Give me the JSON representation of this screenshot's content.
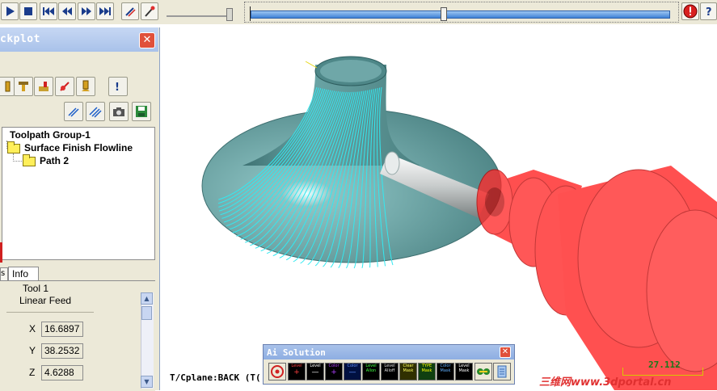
{
  "toolbar": {
    "buttons": [
      "play-icon",
      "stop-icon",
      "skip-start-icon",
      "step-back-icon",
      "step-forward-icon",
      "skip-end-icon",
      "stylus-icon",
      "wand-icon"
    ],
    "right_buttons": [
      "alert-icon",
      "help-icon"
    ]
  },
  "panel": {
    "title": "ckplot",
    "close_label": "✕",
    "icon_row1": [
      "tool-icon",
      "holder-icon",
      "stock-icon",
      "collision-icon",
      "shank-icon",
      "question-icon"
    ],
    "icon_row2": [
      "diagonal-lines-icon",
      "hatch-icon",
      "camera-icon",
      "save-icon"
    ],
    "tree": {
      "root": "Toolpath Group-1",
      "items": [
        "Surface Finish Flowline",
        "Path 2"
      ]
    },
    "tabs": {
      "left_partial": "s",
      "info": "Info"
    },
    "info": {
      "tool": "Tool 1",
      "feed": "Linear Feed",
      "coords": [
        {
          "label": "X",
          "value": "16.6897"
        },
        {
          "label": "Y",
          "value": "38.2532"
        },
        {
          "label": "Z",
          "value": "4.6288"
        }
      ]
    }
  },
  "viewport": {
    "status": "T/Cplane:BACK (T(",
    "scale_value": "27.112",
    "watermark": "三维网www.3dportal.cn"
  },
  "ai_toolbar": {
    "title": "Ai Solution",
    "close_label": "✕",
    "buttons": [
      {
        "top": "",
        "bottom": "",
        "icon": "target-icon"
      },
      {
        "top": "Level",
        "bottom": "+"
      },
      {
        "top": "Level",
        "bottom": "—"
      },
      {
        "top": "Color",
        "bottom": "+"
      },
      {
        "top": "Color",
        "bottom": "—"
      },
      {
        "top": "Level",
        "bottom": "Allon"
      },
      {
        "top": "Level",
        "bottom": "Alloff"
      },
      {
        "top": "Clear",
        "bottom": "Mask"
      },
      {
        "top": "TYPE",
        "bottom": "Mask"
      },
      {
        "top": "Color",
        "bottom": "Mask"
      },
      {
        "top": "Level",
        "bottom": "Mask"
      }
    ],
    "extra_icons": [
      "gear-link-icon",
      "notebook-icon"
    ]
  },
  "colors": {
    "part": "#5e9495",
    "toolpath": "#33e8f0",
    "holder": "#ff2020",
    "progress": "#3f82d6"
  }
}
